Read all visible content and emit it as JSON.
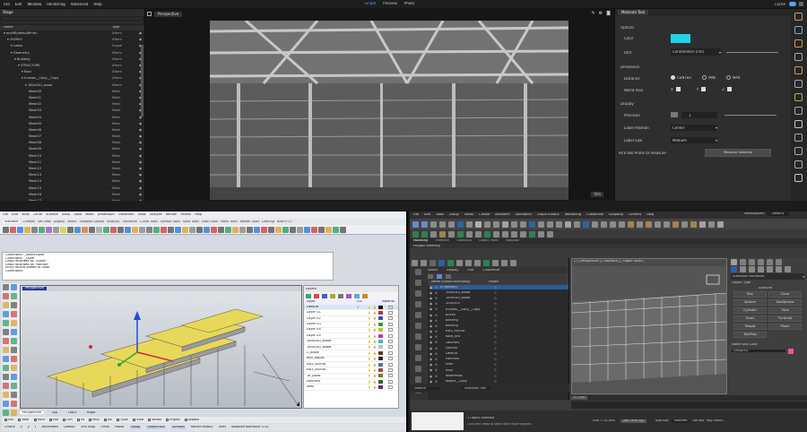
{
  "top_app": {
    "menu": [
      "File",
      "Edit",
      "Window",
      "Rendering",
      "Advanced",
      "Help"
    ],
    "modes": [
      "Graph",
      "Preview",
      "Photo"
    ],
    "right_user": "Cache",
    "stage": {
      "title": "Stage",
      "headers": [
        "Name",
        "Type",
        ""
      ],
      "rows": [
        {
          "name": "envRfl|defaultPrim)",
          "type": "Xform"
        },
        {
          "name": "200903",
          "type": "Xform"
        },
        {
          "name": "Looks",
          "type": "Scope"
        },
        {
          "name": "Geometry",
          "type": "Xform"
        },
        {
          "name": "Building",
          "type": "Xform"
        },
        {
          "name": "STRUCTURE",
          "type": "Xform"
        },
        {
          "name": "floor",
          "type": "Xform"
        },
        {
          "name": "trusses__Copy__Copy",
          "type": "Xform"
        },
        {
          "name": "180x240_wood",
          "type": "Xform"
        },
        {
          "name": "Mesh00",
          "type": "Mesh"
        },
        {
          "name": "Mesh01",
          "type": "Mesh"
        },
        {
          "name": "Mesh02",
          "type": "Mesh"
        },
        {
          "name": "Mesh03",
          "type": "Mesh"
        },
        {
          "name": "Mesh04",
          "type": "Mesh"
        },
        {
          "name": "Mesh05",
          "type": "Mesh"
        },
        {
          "name": "Mesh06",
          "type": "Mesh"
        },
        {
          "name": "Mesh07",
          "type": "Mesh"
        },
        {
          "name": "Mesh08",
          "type": "Mesh"
        },
        {
          "name": "Mesh09",
          "type": "Mesh"
        },
        {
          "name": "Mesh10",
          "type": "Mesh"
        },
        {
          "name": "Mesh11",
          "type": "Mesh"
        },
        {
          "name": "Mesh12",
          "type": "Mesh"
        },
        {
          "name": "Mesh13",
          "type": "Mesh"
        },
        {
          "name": "Mesh14",
          "type": "Mesh"
        },
        {
          "name": "Mesh15",
          "type": "Mesh"
        },
        {
          "name": "Mesh16",
          "type": "Mesh"
        },
        {
          "name": "Mesh17",
          "type": "Mesh"
        }
      ]
    },
    "viewport": {
      "camera": "Perspective",
      "corner": "Sim"
    },
    "measure": {
      "tab": "Measure Tool",
      "options_header": "Options",
      "color_label": "Color",
      "color": "#1ed3e6",
      "unit_label": "Unit",
      "unit_value": "Centimeters (cm)",
      "dimension_header": "Dimension",
      "distance_label": "Distance",
      "distance_opts": [
        "CENTER",
        "MIN",
        "MAX"
      ],
      "world_axis_label": "World Axis",
      "axes": [
        "X",
        "Y",
        "Z"
      ],
      "display_header": "Display",
      "precision_label": "Precision",
      "precision_value": "1",
      "label_position_label": "Label Position",
      "label_position_value": "Center",
      "label_size_label": "Label Size",
      "label_size_value": "Medium",
      "pick_text": "Pick two Prims to measure",
      "measure_btn": "Measure Selected"
    }
  },
  "rhino": {
    "menu": [
      "File",
      "Edit",
      "View",
      "Curve",
      "Surface",
      "SubD",
      "Solid",
      "Mesh",
      "Dimension",
      "Transform",
      "Tools",
      "Analyze",
      "Render",
      "Panels",
      "Help"
    ],
    "tabs": [
      "Standard",
      "CPlanes",
      "Set View",
      "Display",
      "Select",
      "Viewport Layout",
      "Visibility",
      "Transform",
      "Curve Tools",
      "Surface Tools",
      "Solid Tools",
      "SubD Tools",
      "Mesh Tools",
      "Render Tools",
      "Drafting",
      "New in V7"
    ],
    "command_lines": [
      "Command: _SelectLayer",
      "Command: _Layer",
      "Undo recorded as \"Erase\"",
      "Undo recorded as \"Render\"",
      "Entry record added to undo",
      "Command:"
    ],
    "viewport_tab": "Perspective",
    "layers_title": "Layers",
    "layer_headers": [
      "Layer",
      "Cur",
      "",
      "Material"
    ],
    "layers": [
      {
        "name": "Default",
        "color": "#000000"
      },
      {
        "name": "Layer 01",
        "color": "#c03030"
      },
      {
        "name": "Layer 02",
        "color": "#3050c0"
      },
      {
        "name": "Layer 03",
        "color": "#30a030"
      },
      {
        "name": "Layer 04",
        "color": "#c0c030"
      },
      {
        "name": "Layer 05",
        "color": "#c030c0"
      },
      {
        "name": "180x240_wood",
        "color": "#30c0c0"
      },
      {
        "name": "180x240_wood",
        "color": "#c0c0c0"
      },
      {
        "name": "L_angle",
        "color": "#5a3a1a"
      },
      {
        "name": "bolt_adjust",
        "color": "#2a2a2a"
      },
      {
        "name": "Ew3_colFlat",
        "color": "#4a7a9a"
      },
      {
        "name": "Ew3_colFlat",
        "color": "#9a4a4a"
      },
      {
        "name": "1e_point",
        "color": "#7a7a2a"
      },
      {
        "name": "columns",
        "color": "#2a6a2a"
      },
      {
        "name": "shell",
        "color": "#6a2a6a"
      }
    ],
    "bottom_tabs": [
      "Perspective",
      "Top",
      "Front",
      "Right"
    ],
    "osnap": [
      "End",
      "Near",
      "Point",
      "Mid",
      "Cen",
      "Int",
      "Perp",
      "Tan",
      "Quad",
      "Knot",
      "Vertex",
      "Project",
      "Disable"
    ],
    "status": [
      "CPlane",
      "x",
      "y",
      "z",
      "Millimeters",
      "Default",
      "Grid Snap",
      "Ortho",
      "Planar",
      "Osnap",
      "SmartTrack",
      "Gumball",
      "Record History",
      "Filter",
      "Absolute tolerance: 0.01"
    ]
  },
  "max": {
    "menu": [
      "File",
      "Edit",
      "Tools",
      "Group",
      "Views",
      "Create",
      "Modifiers",
      "Animation",
      "Graph Editors",
      "Rendering",
      "Customize",
      "Scripting",
      "Content",
      "Help"
    ],
    "workspace_label": "Workspaces:",
    "workspace_value": "Default",
    "ribbon_tabs": [
      "Modeling",
      "Freeform",
      "Selection",
      "Object Paint",
      "Populate"
    ],
    "ribbon_sub": "Polygon Modeling",
    "explorer_tabs": [
      "Select",
      "Display",
      "Edit",
      "Customize"
    ],
    "explorer_header": [
      "Name (Sorted Ascending)",
      "Frozen"
    ],
    "scene_rows": [
      "0 (default)",
      "180x240_wood",
      "180x240_wood",
      "200x200",
      "trusses__Copy__Copy",
      "Bricks",
      "bearing",
      "bearing",
      "Ew3_colFlat",
      "solid_bra",
      "columns",
      "column",
      "Default",
      "columns",
      "shell",
      "floor",
      "lowermost",
      "object__Copy"
    ],
    "viewport_label": "[+] [Perspective ] [ Standard ] [ Edged Faces ]",
    "cmd_panel_title": "Standard Primitives",
    "object_type_header": "Object Type",
    "autogrid": "AutoGrid",
    "primitives": [
      "Box",
      "Cone",
      "Sphere",
      "GeoSphere",
      "Cylinder",
      "Tube",
      "Torus",
      "Pyramid",
      "Teapot",
      "Plane",
      "TextPlus"
    ],
    "name_color_header": "Name and Color",
    "name_value": "Group001",
    "timeline_value": "0 / 100",
    "status_main": "1 Object Selected",
    "status_hint": "Click and drag to select and move objects",
    "selection_set": "Selection Set:",
    "layer_default": "Default",
    "auto_key": "Auto Key",
    "selected": "Selected",
    "set_key": "Set Key",
    "key_filters": "Key Filters...",
    "frame": "0",
    "grid": "Grid = 10.0cm",
    "add_time_tag": "Add Time Tag"
  }
}
